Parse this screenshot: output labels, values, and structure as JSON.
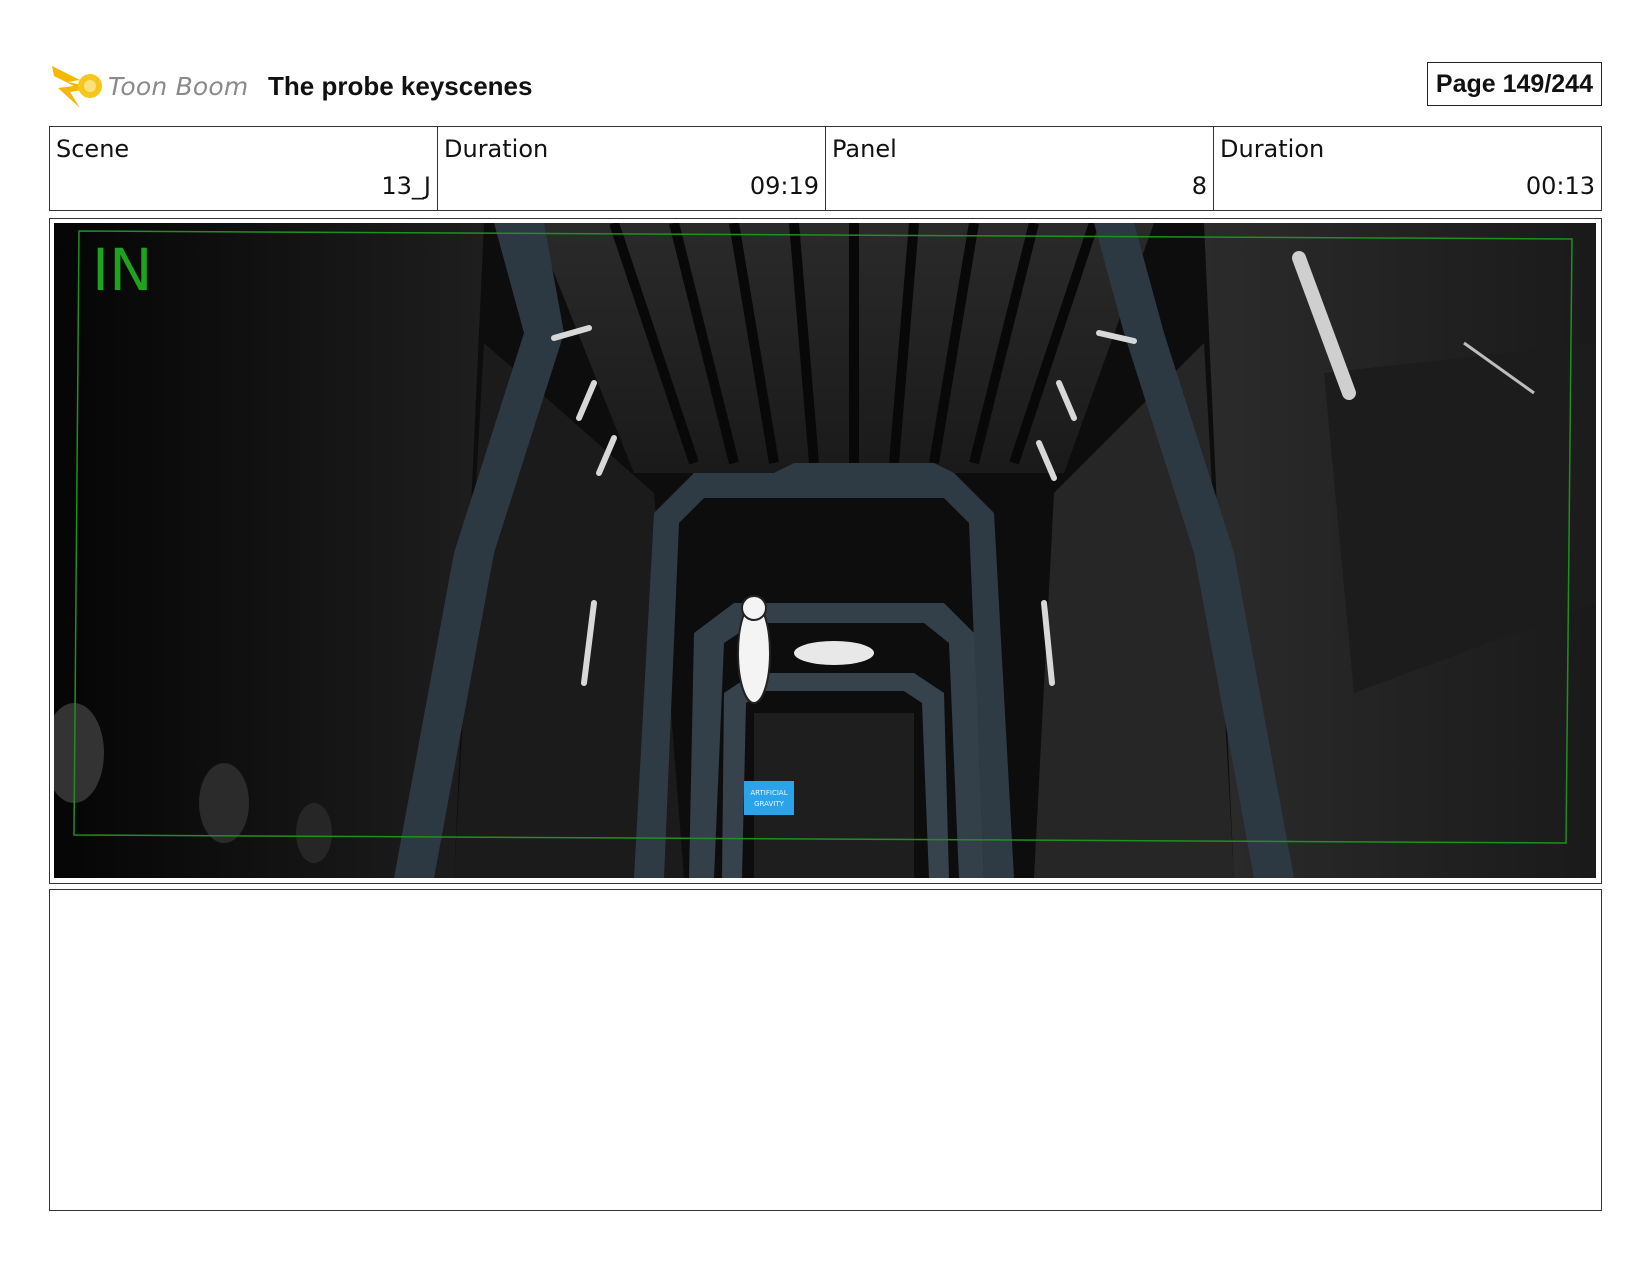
{
  "header": {
    "brand": "Toon Boom",
    "project_title": "The probe keyscenes",
    "page_label": "Page 149/244",
    "logo_icon": "toon-boom-comet-icon",
    "logo_color": "#f5b800"
  },
  "info": {
    "scene_label": "Scene",
    "scene_value": "13_J",
    "scene_duration_label": "Duration",
    "scene_duration_value": "09:19",
    "panel_label": "Panel",
    "panel_value": "8",
    "panel_duration_label": "Duration",
    "panel_duration_value": "00:13"
  },
  "panel": {
    "overlay_label": "IN",
    "overlay_color": "#1fa31f",
    "sign_text_line1": "ARTIFICIAL",
    "sign_text_line2": "GRAVITY",
    "sign_color": "#2aa3e8"
  },
  "notes": {
    "text": ""
  }
}
